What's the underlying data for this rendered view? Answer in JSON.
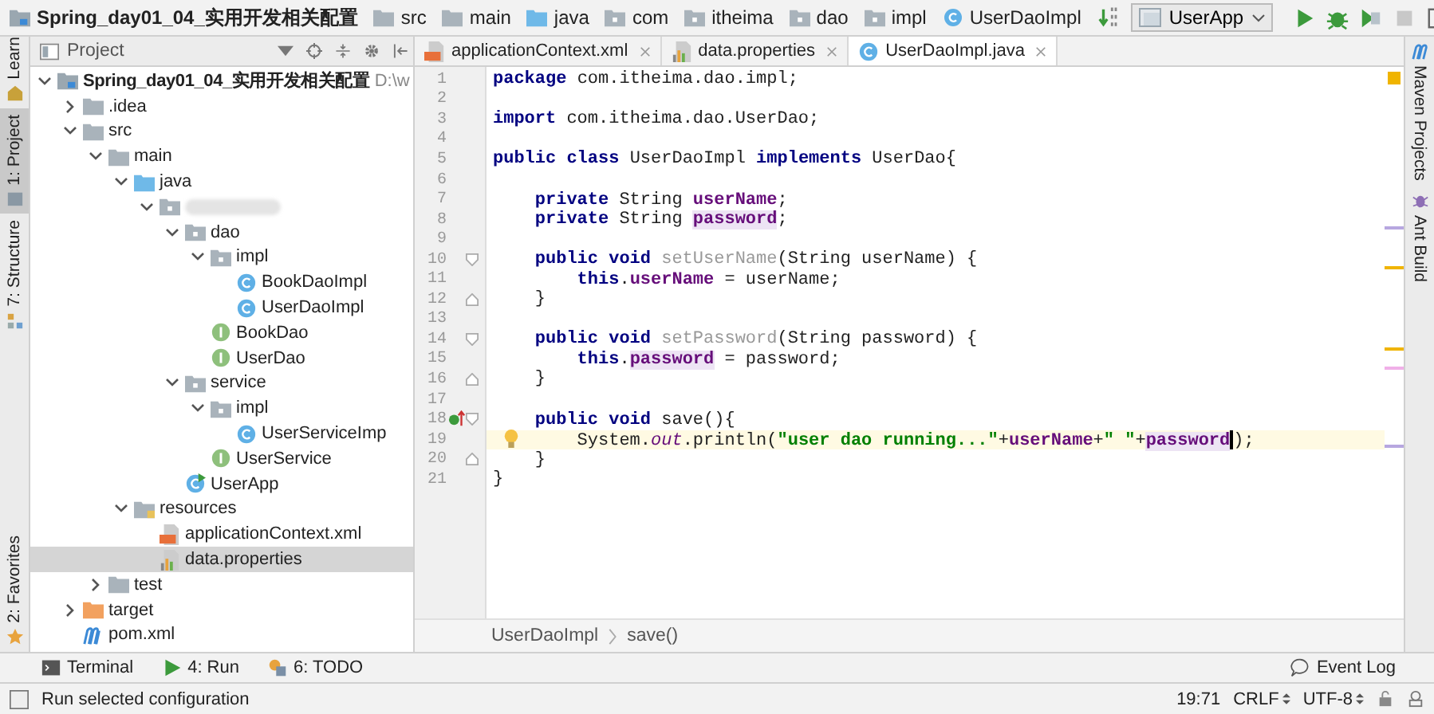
{
  "breadcrumbs": [
    {
      "label": "Spring_day01_04_实用开发相关配置",
      "kind": "module"
    },
    {
      "label": "src",
      "kind": "folder"
    },
    {
      "label": "main",
      "kind": "folder"
    },
    {
      "label": "java",
      "kind": "source"
    },
    {
      "label": "com",
      "kind": "package"
    },
    {
      "label": "itheima",
      "kind": "package"
    },
    {
      "label": "dao",
      "kind": "package"
    },
    {
      "label": "impl",
      "kind": "package"
    },
    {
      "label": "UserDaoImpl",
      "kind": "class"
    }
  ],
  "run_config": {
    "label": "UserApp"
  },
  "left_tool_tabs": [
    {
      "label": "Learn",
      "selected": false,
      "kind": "learn"
    },
    {
      "label": "1: Project",
      "selected": true,
      "kind": "project"
    },
    {
      "label": "7: Structure",
      "selected": false,
      "kind": "structure"
    },
    {
      "label": "2: Favorites",
      "selected": false,
      "kind": "favorites"
    }
  ],
  "right_tool_tabs": [
    {
      "label": "Maven Projects",
      "kind": "maven"
    },
    {
      "label": "Ant Build",
      "kind": "ant"
    }
  ],
  "project_panel": {
    "title": "Project",
    "tree": [
      {
        "label": "Spring_day01_04_实用开发相关配置",
        "path": "D:\\w",
        "kind": "module",
        "expanded": true,
        "selected": false,
        "children": [
          {
            "label": ".idea",
            "kind": "folder",
            "expanded": false,
            "selected": false
          },
          {
            "label": "src",
            "kind": "folder",
            "expanded": true,
            "selected": false,
            "children": [
              {
                "label": "main",
                "kind": "folder",
                "expanded": true,
                "selected": false,
                "children": [
                  {
                    "label": "java",
                    "kind": "source",
                    "expanded": true,
                    "selected": false,
                    "children": [
                      {
                        "redacted": true,
                        "kind": "package",
                        "expanded": true,
                        "selected": false,
                        "children": [
                          {
                            "label": "dao",
                            "kind": "package",
                            "expanded": true,
                            "selected": false,
                            "children": [
                              {
                                "label": "impl",
                                "kind": "package",
                                "expanded": true,
                                "selected": false,
                                "children": [
                                  {
                                    "label": "BookDaoImpl",
                                    "kind": "class",
                                    "selected": false
                                  },
                                  {
                                    "label": "UserDaoImpl",
                                    "kind": "class",
                                    "selected": false
                                  }
                                ]
                              },
                              {
                                "label": "BookDao",
                                "kind": "interface",
                                "selected": false
                              },
                              {
                                "label": "UserDao",
                                "kind": "interface",
                                "selected": false
                              }
                            ]
                          },
                          {
                            "label": "service",
                            "kind": "package",
                            "expanded": true,
                            "selected": false,
                            "children": [
                              {
                                "label": "impl",
                                "kind": "package",
                                "expanded": true,
                                "selected": false,
                                "children": [
                                  {
                                    "label": "UserServiceImp",
                                    "kind": "class",
                                    "selected": false
                                  }
                                ]
                              },
                              {
                                "label": "UserService",
                                "kind": "interface",
                                "selected": false
                              }
                            ]
                          },
                          {
                            "label": "UserApp",
                            "kind": "main",
                            "selected": false
                          }
                        ]
                      }
                    ]
                  },
                  {
                    "label": "resources",
                    "kind": "resources",
                    "expanded": true,
                    "selected": false,
                    "children": [
                      {
                        "label": "applicationContext.xml",
                        "kind": "xml",
                        "selected": false
                      },
                      {
                        "label": "data.properties",
                        "kind": "properties",
                        "selected": true
                      }
                    ]
                  }
                ]
              },
              {
                "label": "test",
                "kind": "folder",
                "expanded": false,
                "selected": false
              }
            ]
          },
          {
            "label": "target",
            "kind": "excluded",
            "expanded": false,
            "selected": false
          },
          {
            "label": "pom.xml",
            "kind": "maven",
            "selected": false
          }
        ]
      }
    ]
  },
  "editor_tabs": [
    {
      "label": "applicationContext.xml",
      "kind": "xml",
      "selected": false
    },
    {
      "label": "data.properties",
      "kind": "properties",
      "selected": false
    },
    {
      "label": "UserDaoImpl.java",
      "kind": "class",
      "selected": true
    }
  ],
  "code": [
    {
      "number": "1",
      "current": false,
      "tokens": [
        {
          "kind": "keyword",
          "text": "package"
        },
        {
          "kind": "plain",
          "text": " com.itheima.dao.impl;"
        }
      ]
    },
    {
      "number": "2",
      "current": false
    },
    {
      "number": "3",
      "current": false,
      "tokens": [
        {
          "kind": "keyword",
          "text": "import"
        },
        {
          "kind": "plain",
          "text": " com.itheima.dao.UserDao;"
        }
      ]
    },
    {
      "number": "4",
      "current": false
    },
    {
      "number": "5",
      "current": false,
      "tokens": [
        {
          "kind": "keyword",
          "text": "public class"
        },
        {
          "kind": "plain",
          "text": " UserDaoImpl "
        },
        {
          "kind": "keyword",
          "text": "implements"
        },
        {
          "kind": "plain",
          "text": " UserDao{"
        }
      ],
      "children": [
        {
          "number": "6",
          "current": false
        },
        {
          "number": "7",
          "current": false,
          "tokens": [
            {
              "kind": "keyword",
              "text": "private"
            },
            {
              "kind": "plain",
              "text": " String "
            },
            {
              "kind": "field",
              "text": "userName"
            },
            {
              "kind": "plain",
              "text": ";"
            }
          ]
        },
        {
          "number": "8",
          "current": false,
          "tokens": [
            {
              "kind": "keyword",
              "text": "private"
            },
            {
              "kind": "plain",
              "text": " String "
            },
            {
              "kind": "field-usage",
              "text": "password"
            },
            {
              "kind": "plain",
              "text": ";"
            }
          ]
        },
        {
          "number": "9",
          "current": false
        },
        {
          "number": "10",
          "current": false,
          "gutter": [
            {
              "kind": "fold-start"
            }
          ],
          "tokens": [
            {
              "kind": "keyword",
              "text": "public void "
            },
            {
              "kind": "unused",
              "text": "setUserName"
            },
            {
              "kind": "plain",
              "text": "(String userName) {"
            }
          ],
          "children": [
            {
              "number": "11",
              "current": false,
              "tokens": [
                {
                  "kind": "keyword",
                  "text": "this"
                },
                {
                  "kind": "plain",
                  "text": "."
                },
                {
                  "kind": "field",
                  "text": "userName"
                },
                {
                  "kind": "plain",
                  "text": " = userName;"
                }
              ]
            }
          ]
        },
        {
          "number": "12",
          "current": false,
          "gutter": [
            {
              "kind": "fold-end"
            }
          ],
          "tokens": [
            {
              "kind": "plain",
              "text": "}"
            }
          ]
        },
        {
          "number": "13",
          "current": false
        },
        {
          "number": "14",
          "current": false,
          "gutter": [
            {
              "kind": "fold-start"
            }
          ],
          "tokens": [
            {
              "kind": "keyword",
              "text": "public void "
            },
            {
              "kind": "unused",
              "text": "setPassword"
            },
            {
              "kind": "plain",
              "text": "(String password) {"
            }
          ],
          "children": [
            {
              "number": "15",
              "current": false,
              "tokens": [
                {
                  "kind": "keyword",
                  "text": "this"
                },
                {
                  "kind": "plain",
                  "text": "."
                },
                {
                  "kind": "field-usage",
                  "text": "password"
                },
                {
                  "kind": "plain",
                  "text": " = password;"
                }
              ]
            }
          ]
        },
        {
          "number": "16",
          "current": false,
          "gutter": [
            {
              "kind": "fold-end"
            }
          ],
          "tokens": [
            {
              "kind": "plain",
              "text": "}"
            }
          ]
        },
        {
          "number": "17",
          "current": false
        },
        {
          "number": "18",
          "current": false,
          "gutter": [
            {
              "kind": "implements"
            },
            {
              "kind": "fold-start"
            }
          ],
          "tokens": [
            {
              "kind": "keyword",
              "text": "public void"
            },
            {
              "kind": "plain",
              "text": " save(){"
            }
          ],
          "children": [
            {
              "number": "19",
              "current": true,
              "gutter": [
                {
                  "kind": "bulb"
                }
              ],
              "tokens": [
                {
                  "kind": "plain",
                  "text": "System."
                },
                {
                  "kind": "static",
                  "text": "out"
                },
                {
                  "kind": "plain",
                  "text": ".println("
                },
                {
                  "kind": "string",
                  "text": "\"user dao running...\""
                },
                {
                  "kind": "plain",
                  "text": "+"
                },
                {
                  "kind": "field",
                  "text": "userName"
                },
                {
                  "kind": "plain",
                  "text": "+"
                },
                {
                  "kind": "string",
                  "text": "\" \""
                },
                {
                  "kind": "plain",
                  "text": "+"
                },
                {
                  "kind": "field-caret",
                  "text": "password"
                },
                {
                  "kind": "plain",
                  "text": ");"
                }
              ]
            }
          ]
        },
        {
          "number": "20",
          "current": false,
          "gutter": [
            {
              "kind": "fold-end"
            }
          ],
          "tokens": [
            {
              "kind": "plain",
              "text": "}"
            }
          ]
        }
      ]
    },
    {
      "number": "21",
      "current": false,
      "tokens": [
        {
          "kind": "plain",
          "text": "}"
        }
      ]
    }
  ],
  "editor_breadcrumbs": [
    "UserDaoImpl",
    "save()"
  ],
  "bottom_tool_tabs": [
    {
      "label": "Terminal",
      "kind": "terminal"
    },
    {
      "label": "4: Run",
      "kind": "run"
    },
    {
      "label": "6: TODO",
      "kind": "todo"
    }
  ],
  "event_log": "Event Log",
  "status_bar": {
    "message": "Run selected configuration",
    "position": "19:71",
    "line_separator": "CRLF",
    "encoding": "UTF-8"
  }
}
